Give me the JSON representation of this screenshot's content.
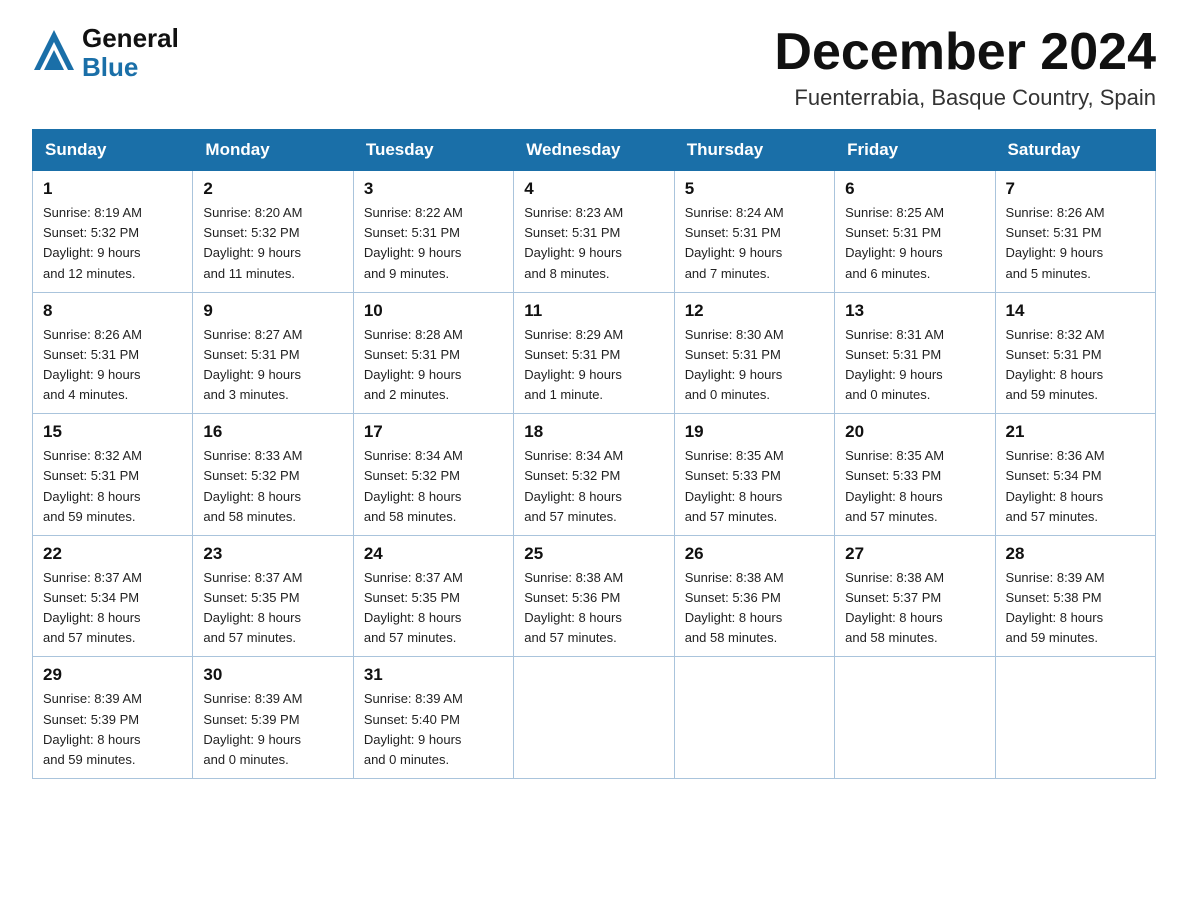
{
  "header": {
    "logo_general": "General",
    "logo_blue": "Blue",
    "month_title": "December 2024",
    "location": "Fuenterrabia, Basque Country, Spain"
  },
  "days_of_week": [
    "Sunday",
    "Monday",
    "Tuesday",
    "Wednesday",
    "Thursday",
    "Friday",
    "Saturday"
  ],
  "weeks": [
    [
      {
        "day": "1",
        "sunrise": "8:19 AM",
        "sunset": "5:32 PM",
        "daylight": "9 hours and 12 minutes."
      },
      {
        "day": "2",
        "sunrise": "8:20 AM",
        "sunset": "5:32 PM",
        "daylight": "9 hours and 11 minutes."
      },
      {
        "day": "3",
        "sunrise": "8:22 AM",
        "sunset": "5:31 PM",
        "daylight": "9 hours and 9 minutes."
      },
      {
        "day": "4",
        "sunrise": "8:23 AM",
        "sunset": "5:31 PM",
        "daylight": "9 hours and 8 minutes."
      },
      {
        "day": "5",
        "sunrise": "8:24 AM",
        "sunset": "5:31 PM",
        "daylight": "9 hours and 7 minutes."
      },
      {
        "day": "6",
        "sunrise": "8:25 AM",
        "sunset": "5:31 PM",
        "daylight": "9 hours and 6 minutes."
      },
      {
        "day": "7",
        "sunrise": "8:26 AM",
        "sunset": "5:31 PM",
        "daylight": "9 hours and 5 minutes."
      }
    ],
    [
      {
        "day": "8",
        "sunrise": "8:26 AM",
        "sunset": "5:31 PM",
        "daylight": "9 hours and 4 minutes."
      },
      {
        "day": "9",
        "sunrise": "8:27 AM",
        "sunset": "5:31 PM",
        "daylight": "9 hours and 3 minutes."
      },
      {
        "day": "10",
        "sunrise": "8:28 AM",
        "sunset": "5:31 PM",
        "daylight": "9 hours and 2 minutes."
      },
      {
        "day": "11",
        "sunrise": "8:29 AM",
        "sunset": "5:31 PM",
        "daylight": "9 hours and 1 minute."
      },
      {
        "day": "12",
        "sunrise": "8:30 AM",
        "sunset": "5:31 PM",
        "daylight": "9 hours and 0 minutes."
      },
      {
        "day": "13",
        "sunrise": "8:31 AM",
        "sunset": "5:31 PM",
        "daylight": "9 hours and 0 minutes."
      },
      {
        "day": "14",
        "sunrise": "8:32 AM",
        "sunset": "5:31 PM",
        "daylight": "8 hours and 59 minutes."
      }
    ],
    [
      {
        "day": "15",
        "sunrise": "8:32 AM",
        "sunset": "5:31 PM",
        "daylight": "8 hours and 59 minutes."
      },
      {
        "day": "16",
        "sunrise": "8:33 AM",
        "sunset": "5:32 PM",
        "daylight": "8 hours and 58 minutes."
      },
      {
        "day": "17",
        "sunrise": "8:34 AM",
        "sunset": "5:32 PM",
        "daylight": "8 hours and 58 minutes."
      },
      {
        "day": "18",
        "sunrise": "8:34 AM",
        "sunset": "5:32 PM",
        "daylight": "8 hours and 57 minutes."
      },
      {
        "day": "19",
        "sunrise": "8:35 AM",
        "sunset": "5:33 PM",
        "daylight": "8 hours and 57 minutes."
      },
      {
        "day": "20",
        "sunrise": "8:35 AM",
        "sunset": "5:33 PM",
        "daylight": "8 hours and 57 minutes."
      },
      {
        "day": "21",
        "sunrise": "8:36 AM",
        "sunset": "5:34 PM",
        "daylight": "8 hours and 57 minutes."
      }
    ],
    [
      {
        "day": "22",
        "sunrise": "8:37 AM",
        "sunset": "5:34 PM",
        "daylight": "8 hours and 57 minutes."
      },
      {
        "day": "23",
        "sunrise": "8:37 AM",
        "sunset": "5:35 PM",
        "daylight": "8 hours and 57 minutes."
      },
      {
        "day": "24",
        "sunrise": "8:37 AM",
        "sunset": "5:35 PM",
        "daylight": "8 hours and 57 minutes."
      },
      {
        "day": "25",
        "sunrise": "8:38 AM",
        "sunset": "5:36 PM",
        "daylight": "8 hours and 57 minutes."
      },
      {
        "day": "26",
        "sunrise": "8:38 AM",
        "sunset": "5:36 PM",
        "daylight": "8 hours and 58 minutes."
      },
      {
        "day": "27",
        "sunrise": "8:38 AM",
        "sunset": "5:37 PM",
        "daylight": "8 hours and 58 minutes."
      },
      {
        "day": "28",
        "sunrise": "8:39 AM",
        "sunset": "5:38 PM",
        "daylight": "8 hours and 59 minutes."
      }
    ],
    [
      {
        "day": "29",
        "sunrise": "8:39 AM",
        "sunset": "5:39 PM",
        "daylight": "8 hours and 59 minutes."
      },
      {
        "day": "30",
        "sunrise": "8:39 AM",
        "sunset": "5:39 PM",
        "daylight": "9 hours and 0 minutes."
      },
      {
        "day": "31",
        "sunrise": "8:39 AM",
        "sunset": "5:40 PM",
        "daylight": "9 hours and 0 minutes."
      },
      null,
      null,
      null,
      null
    ]
  ],
  "labels": {
    "sunrise": "Sunrise:",
    "sunset": "Sunset:",
    "daylight": "Daylight:"
  }
}
